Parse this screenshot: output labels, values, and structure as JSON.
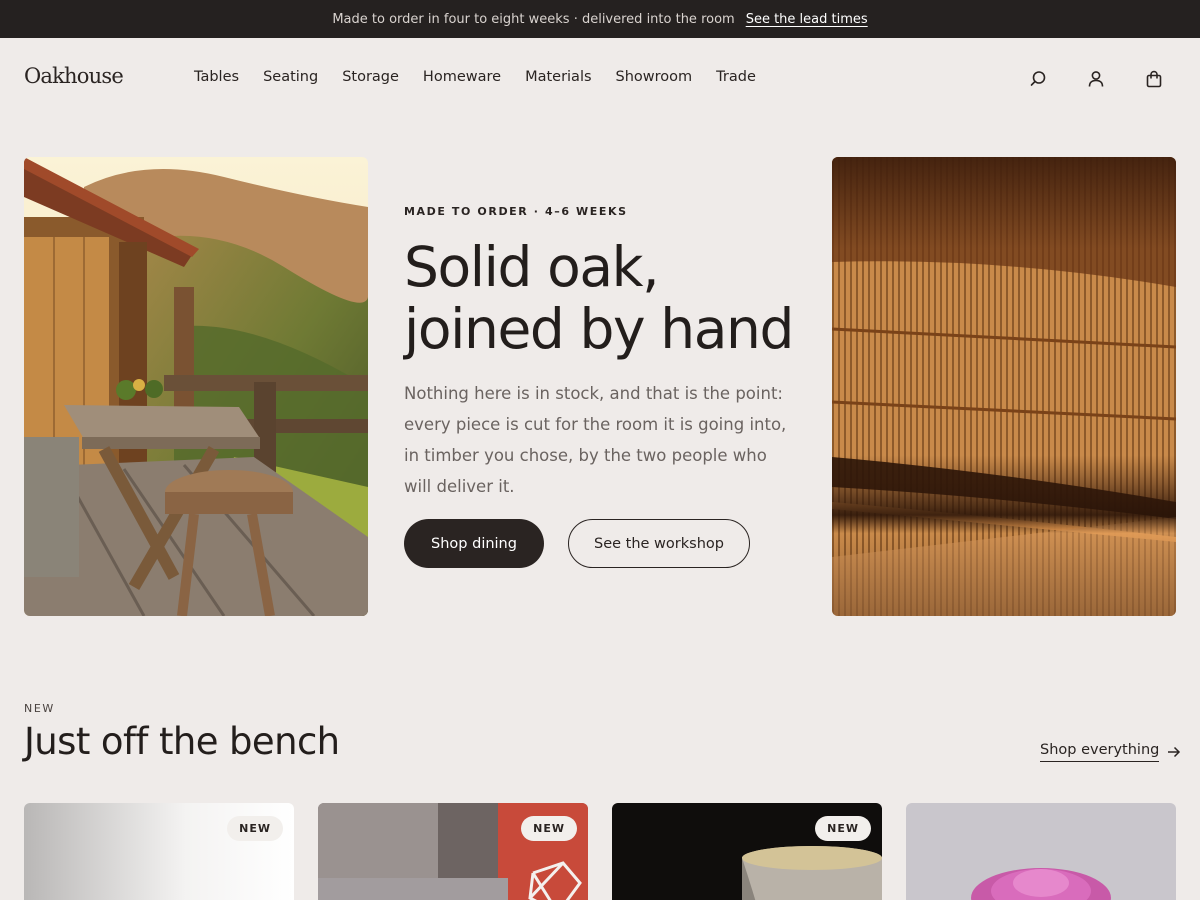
{
  "announcement": {
    "text": "Made to order in four to eight weeks · delivered into the room",
    "link": "See the lead times"
  },
  "brand": {
    "name": "Oakhouse"
  },
  "nav": {
    "items": [
      "Tables",
      "Seating",
      "Storage",
      "Homeware",
      "Materials",
      "Showroom",
      "Trade"
    ]
  },
  "header_icons": [
    "search-icon",
    "account-icon",
    "bag-icon"
  ],
  "hero": {
    "eyebrow": "MADE TO ORDER · 4–6 WEEKS",
    "headline_line1": "Solid oak,",
    "headline_line2": "joined by hand",
    "body": "Nothing here is in stock, and that is the point: every piece is cut for the room it is going into, in timber you chose, by the two people who will deliver it.",
    "primary_button": "Shop dining",
    "secondary_button": "See the workshop"
  },
  "new_section": {
    "eyebrow": "NEW",
    "title": "Just off the bench",
    "link": "Shop everything"
  },
  "products": [
    {
      "badge": "NEW"
    },
    {
      "badge": "NEW"
    },
    {
      "badge": "NEW"
    },
    {
      "badge": ""
    }
  ],
  "colors": {
    "background": "#efebe9",
    "announcement_bar": "#252120",
    "text": "#2a2422",
    "muted_text": "#6a6360",
    "primary_button": "#2a2422"
  }
}
